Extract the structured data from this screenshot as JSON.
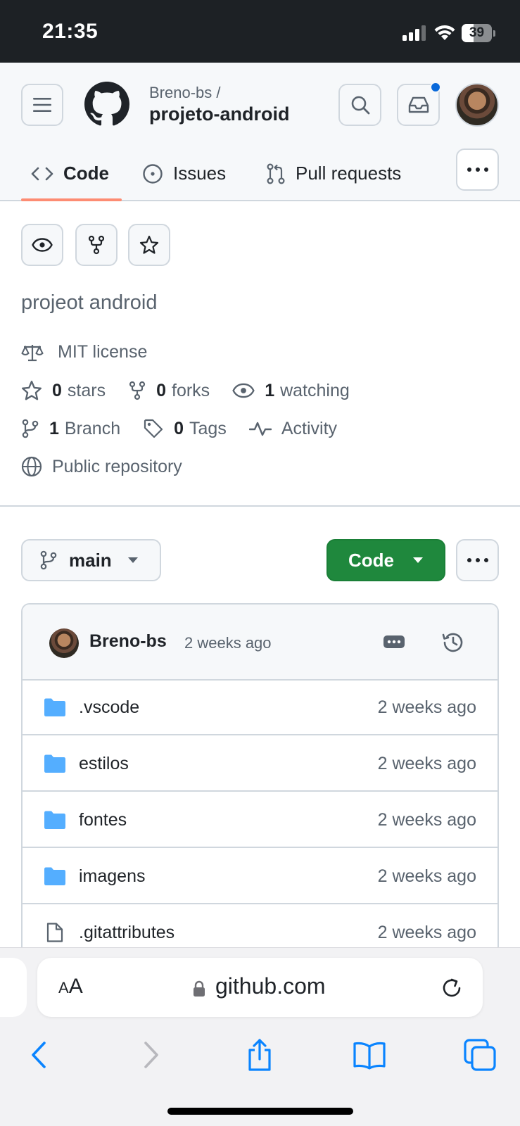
{
  "status_bar": {
    "time": "21:35",
    "battery_percent": "39",
    "battery_level": 0.39,
    "icons": [
      "signal-icon",
      "wifi-icon",
      "battery-icon"
    ]
  },
  "header": {
    "owner": "Breno-bs /",
    "repo_name": "projeto-android",
    "icons": [
      "hamburger-menu-icon",
      "github-logo",
      "search-icon",
      "inbox-icon",
      "user-avatar"
    ],
    "notification_dot_color": "#0969da"
  },
  "tabs": {
    "items": [
      {
        "label": "Code",
        "icon": "code-icon",
        "active": true
      },
      {
        "label": "Issues",
        "icon": "issue-opened-icon",
        "active": false
      },
      {
        "label": "Pull requests",
        "icon": "git-pull-request-icon",
        "active": false
      }
    ],
    "more_icon": "kebab-horizontal-icon",
    "underline_color": "#fd8c73"
  },
  "repo": {
    "action_icons": [
      "eye-icon",
      "repo-forked-icon",
      "star-icon"
    ],
    "description": "projeot android",
    "license": "MIT license",
    "stars_count": "0",
    "stars_label": "stars",
    "forks_count": "0",
    "forks_label": "forks",
    "watching_count": "1",
    "watching_label": "watching",
    "branch_count": "1",
    "branch_label": "Branch",
    "tags_count": "0",
    "tags_label": "Tags",
    "activity_label": "Activity",
    "visibility": "Public repository"
  },
  "branch_bar": {
    "branch": "main",
    "code_button": "Code",
    "code_button_color": "#1f883d"
  },
  "commit": {
    "author": "Breno-bs",
    "time": "2 weeks ago",
    "icons": [
      "ellipsis-icon",
      "history-icon"
    ]
  },
  "files": [
    {
      "name": ".vscode",
      "type": "folder",
      "date": "2 weeks ago"
    },
    {
      "name": "estilos",
      "type": "folder",
      "date": "2 weeks ago"
    },
    {
      "name": "fontes",
      "type": "folder",
      "date": "2 weeks ago"
    },
    {
      "name": "imagens",
      "type": "folder",
      "date": "2 weeks ago"
    },
    {
      "name": ".gitattributes",
      "type": "file",
      "date": "2 weeks ago"
    }
  ],
  "safari": {
    "text_size_label": "AA",
    "url": "github.com",
    "toolbar_icons": [
      "back-icon",
      "forward-icon",
      "share-icon",
      "bookmarks-icon",
      "tabs-icon"
    ],
    "accent_color": "#0a84ff"
  }
}
